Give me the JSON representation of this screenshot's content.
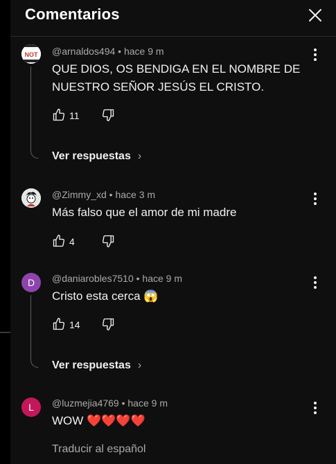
{
  "header": {
    "title": "Comentarios",
    "close_icon": "close-icon"
  },
  "comments": [
    {
      "avatar_text": "NOT",
      "meta": "@arnaldos494 • hace 9 m",
      "text_lines": [
        "QUE DIOS, OS BENDIGA EN EL NOMBRE DE",
        "NUESTRO SEÑOR JESÚS EL CRISTO."
      ],
      "likes": "11",
      "replies_label": "Ver respuestas"
    },
    {
      "avatar_text": "",
      "meta": "@Zimmy_xd • hace 3 m",
      "text_lines": [
        "Más falso que el amor de mi madre"
      ],
      "likes": "4"
    },
    {
      "avatar_text": "D",
      "avatar_color": "#8e44ad",
      "meta": "@daniarobles7510 • hace 9 m",
      "text_lines": [
        "Cristo esta cerca 😱"
      ],
      "likes": "14",
      "replies_label": "Ver respuestas"
    },
    {
      "avatar_text": "L",
      "avatar_color": "#c2185b",
      "meta": "@luzmejia4769 • hace 9 m",
      "text_lines": [
        "WOW ❤️❤️❤️❤️"
      ],
      "translate_label": "Traducir al español"
    }
  ],
  "icons": {
    "like": "thumbs-up-icon",
    "dislike": "thumbs-down-icon",
    "more": "more-vert-icon",
    "chevron": "chevron-right-icon"
  }
}
